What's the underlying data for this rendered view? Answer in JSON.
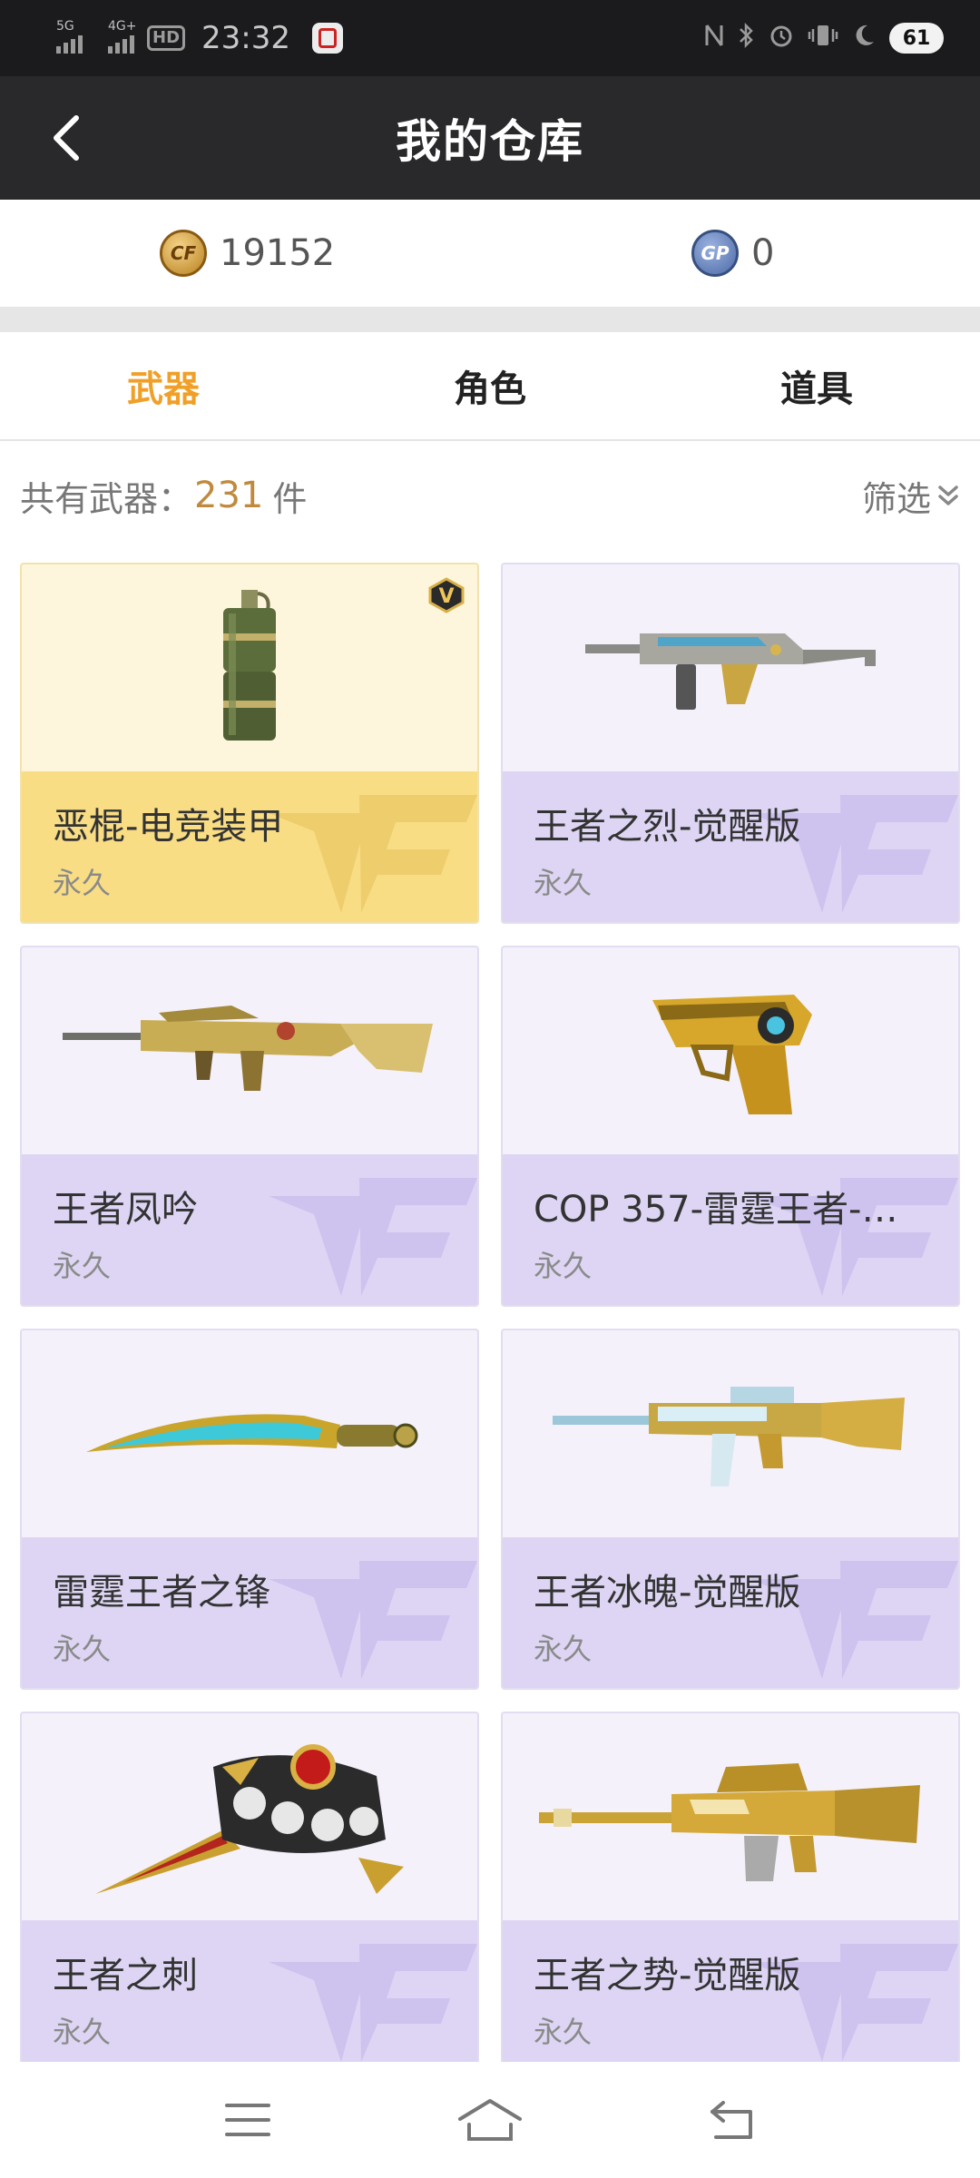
{
  "status_bar": {
    "sig1_label": "5G",
    "sig2_label": "4G+",
    "hd_label": "HD",
    "time": "23:32",
    "battery": "61"
  },
  "header": {
    "title": "我的仓库"
  },
  "currency": {
    "cf_icon_text": "CF",
    "cf_amount": "19152",
    "gp_icon_text": "GP",
    "gp_amount": "0"
  },
  "tabs": [
    {
      "label": "武器",
      "active": true
    },
    {
      "label": "角色",
      "active": false
    },
    {
      "label": "道具",
      "active": false
    }
  ],
  "summary": {
    "label": "共有武器：",
    "count": "231",
    "unit": "件",
    "filter_label": "筛选"
  },
  "vip_badge": "V",
  "items": [
    {
      "name": "恶棍-电竞装甲",
      "duration": "永久",
      "icon": "grenade-icon",
      "highlight": true
    },
    {
      "name": "王者之烈-觉醒版",
      "duration": "永久",
      "icon": "smg-icon",
      "highlight": false
    },
    {
      "name": "王者凤吟",
      "duration": "永久",
      "icon": "rifle-icon",
      "highlight": false
    },
    {
      "name": "COP 357-雷霆王者-…",
      "duration": "永久",
      "icon": "pistol-icon",
      "highlight": false
    },
    {
      "name": "雷霆王者之锋",
      "duration": "永久",
      "icon": "blade-icon",
      "highlight": false
    },
    {
      "name": "王者冰魄-觉醒版",
      "duration": "永久",
      "icon": "ice-rifle-icon",
      "highlight": false
    },
    {
      "name": "王者之刺",
      "duration": "永久",
      "icon": "knuckle-knife-icon",
      "highlight": false
    },
    {
      "name": "王者之势-觉醒版",
      "duration": "永久",
      "icon": "gold-rifle-icon",
      "highlight": false
    }
  ],
  "colors": {
    "accent": "#f0a028",
    "count": "#c08a3e",
    "header_bg": "#29292b",
    "card_purple": "#ddd5f3",
    "card_gold": "#f9dd85"
  }
}
